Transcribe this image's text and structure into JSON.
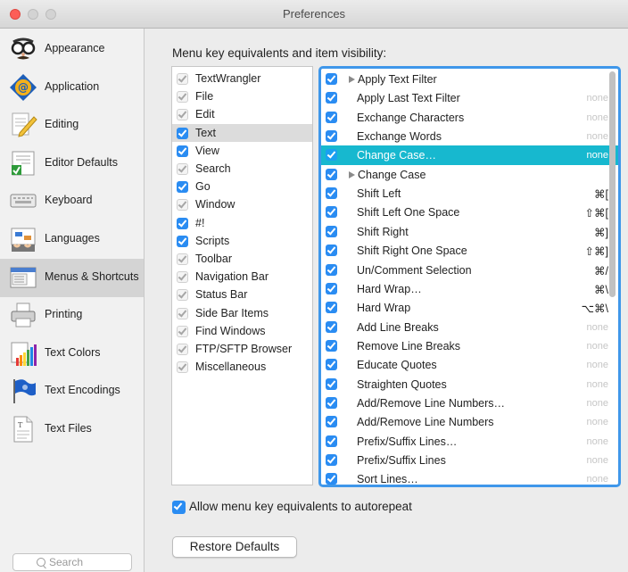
{
  "window": {
    "title": "Preferences"
  },
  "sidebar": {
    "items": [
      {
        "label": "Appearance",
        "icon": "disguise-glasses-icon"
      },
      {
        "label": "Application",
        "icon": "textwrangler-app-icon"
      },
      {
        "label": "Editing",
        "icon": "pencil-paper-icon"
      },
      {
        "label": "Editor Defaults",
        "icon": "editor-defaults-icon"
      },
      {
        "label": "Keyboard",
        "icon": "keyboard-icon"
      },
      {
        "label": "Languages",
        "icon": "languages-icon"
      },
      {
        "label": "Menus & Shortcuts",
        "icon": "menus-icon",
        "selected": true
      },
      {
        "label": "Printing",
        "icon": "printer-icon"
      },
      {
        "label": "Text Colors",
        "icon": "color-swatches-icon"
      },
      {
        "label": "Text Encodings",
        "icon": "flag-icon"
      },
      {
        "label": "Text Files",
        "icon": "text-file-icon"
      }
    ],
    "search_placeholder": "Search"
  },
  "main": {
    "heading": "Menu key equivalents and item visibility:",
    "menus": [
      {
        "label": "TextWrangler",
        "checked": "dim"
      },
      {
        "label": "File",
        "checked": "dim"
      },
      {
        "label": "Edit",
        "checked": "dim"
      },
      {
        "label": "Text",
        "checked": "on",
        "selected": true
      },
      {
        "label": "View",
        "checked": "on"
      },
      {
        "label": "Search",
        "checked": "dim"
      },
      {
        "label": "Go",
        "checked": "on"
      },
      {
        "label": "Window",
        "checked": "dim"
      },
      {
        "label": "#!",
        "checked": "on"
      },
      {
        "label": "Scripts",
        "checked": "on"
      },
      {
        "label": "Toolbar",
        "checked": "dim"
      },
      {
        "label": "Navigation Bar",
        "checked": "dim"
      },
      {
        "label": "Status Bar",
        "checked": "dim"
      },
      {
        "label": "Side Bar Items",
        "checked": "dim"
      },
      {
        "label": "Find Windows",
        "checked": "dim"
      },
      {
        "label": "FTP/SFTP Browser",
        "checked": "dim"
      },
      {
        "label": "Miscellaneous",
        "checked": "dim"
      }
    ],
    "items": [
      {
        "label": "Apply Text Filter",
        "submenu": true,
        "key": ""
      },
      {
        "label": "Apply Last Text Filter",
        "key": "none"
      },
      {
        "label": "Exchange Characters",
        "key": "none"
      },
      {
        "label": "Exchange Words",
        "key": "none"
      },
      {
        "label": "Change Case…",
        "key": "none",
        "selected": true
      },
      {
        "label": "Change Case",
        "submenu": true,
        "key": ""
      },
      {
        "label": "Shift Left",
        "key": "⌘["
      },
      {
        "label": "Shift Left One Space",
        "key": "⇧⌘["
      },
      {
        "label": "Shift Right",
        "key": "⌘]"
      },
      {
        "label": "Shift Right One Space",
        "key": "⇧⌘]"
      },
      {
        "label": "Un/Comment Selection",
        "key": "⌘/"
      },
      {
        "label": "Hard Wrap…",
        "key": "⌘\\"
      },
      {
        "label": "Hard Wrap",
        "key": "⌥⌘\\"
      },
      {
        "label": "Add Line Breaks",
        "key": "none"
      },
      {
        "label": "Remove Line Breaks",
        "key": "none"
      },
      {
        "label": "Educate Quotes",
        "key": "none"
      },
      {
        "label": "Straighten Quotes",
        "key": "none"
      },
      {
        "label": "Add/Remove Line Numbers…",
        "key": "none"
      },
      {
        "label": "Add/Remove Line Numbers",
        "key": "none"
      },
      {
        "label": "Prefix/Suffix Lines…",
        "key": "none"
      },
      {
        "label": "Prefix/Suffix Lines",
        "key": "none"
      },
      {
        "label": "Sort Lines…",
        "key": "none"
      }
    ],
    "autorepeat_label": "Allow menu key equivalents to autorepeat",
    "autorepeat_checked": true,
    "restore_label": "Restore Defaults"
  },
  "colors": {
    "accent": "#2a8cf2",
    "selection": "#17b8cf",
    "focus_ring": "#3f97ea"
  }
}
